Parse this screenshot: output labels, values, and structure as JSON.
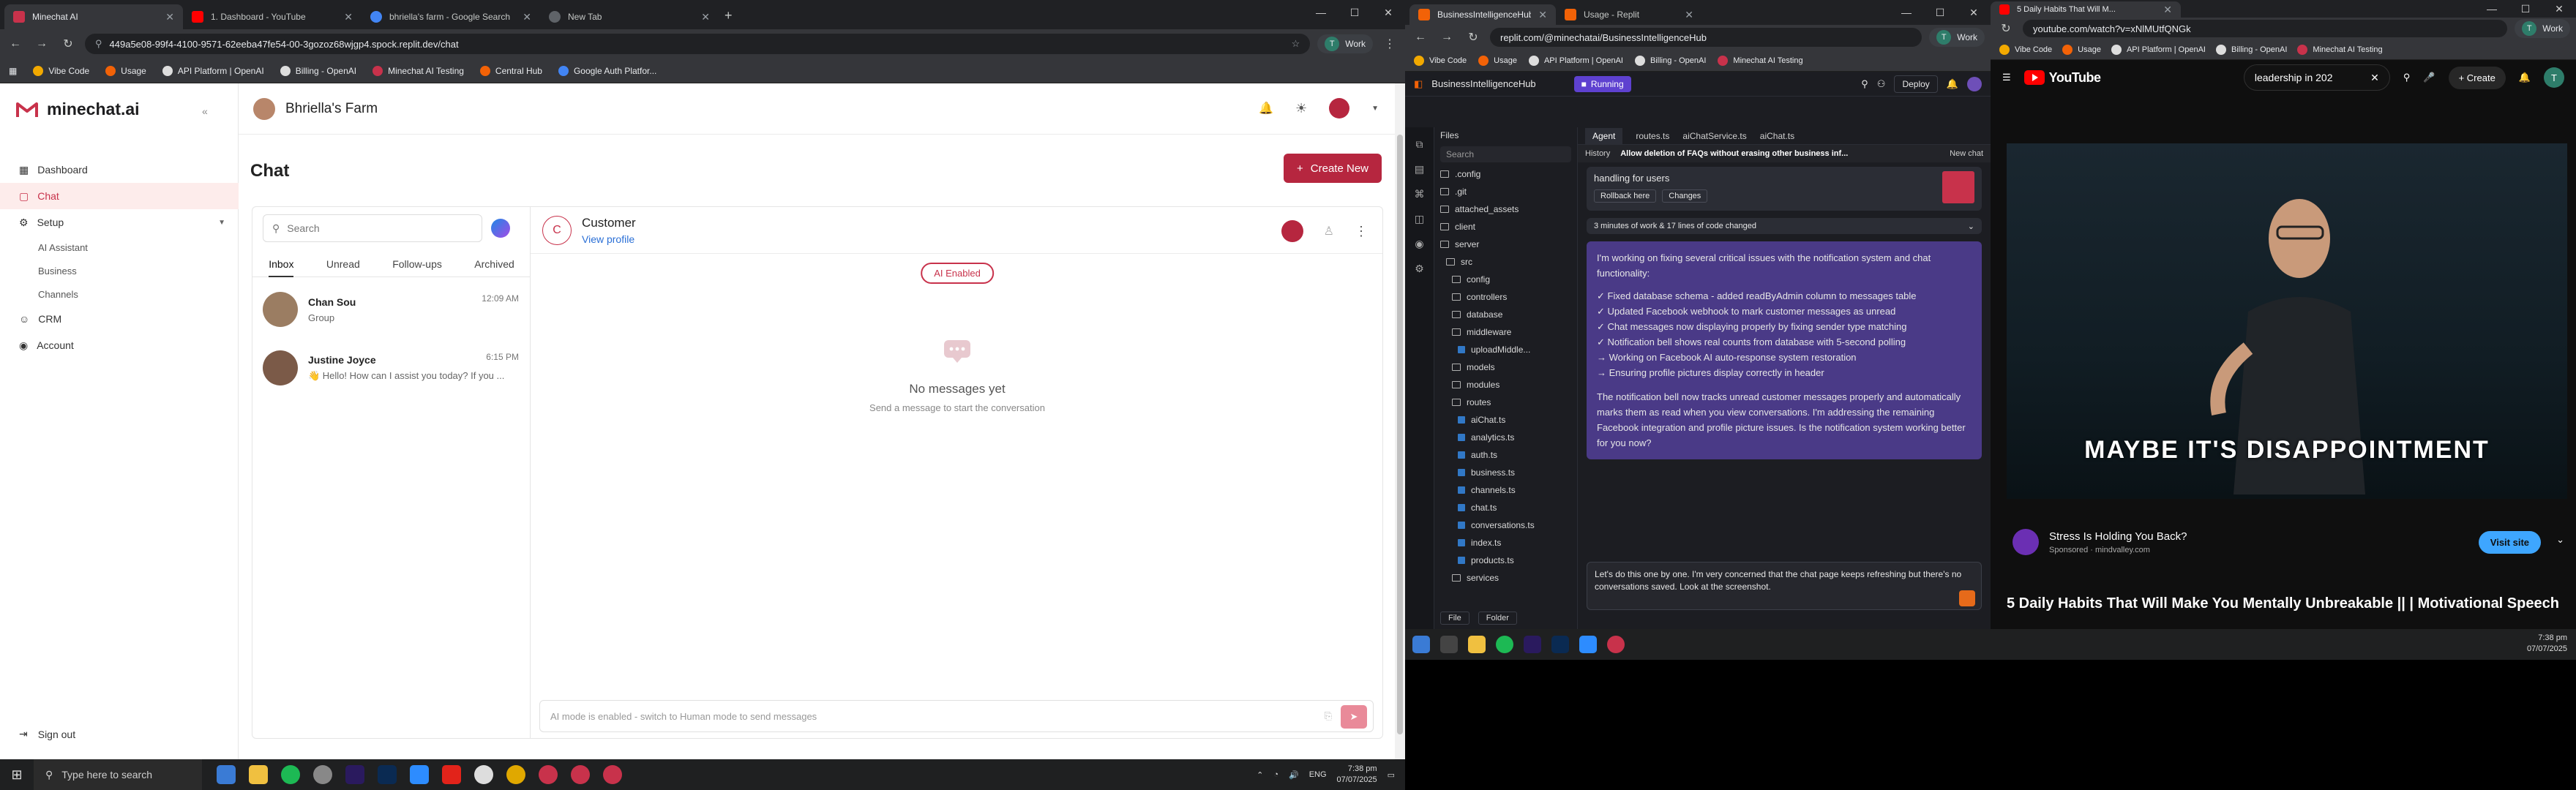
{
  "w1": {
    "tabs": [
      {
        "title": "Minechat AI",
        "color": "#c8324b"
      },
      {
        "title": "1. Dashboard - YouTube",
        "color": "#ff0000"
      },
      {
        "title": "bhriella's farm - Google Search",
        "color": "#4285f4"
      },
      {
        "title": "New Tab",
        "color": "#9aa0a6"
      }
    ],
    "url": "449a5e08-99f4-4100-9571-62eeba47fe54-00-3gozoz68wjgp4.spock.replit.dev/chat",
    "profile": "Work",
    "bookmarks": [
      "Vibe Code",
      "Usage",
      "API Platform | OpenAI",
      "Billing - OpenAI",
      "Minechat AI Testing",
      "Central Hub",
      "Google Auth Platfor..."
    ],
    "sidebar": {
      "brand": "minechat.ai",
      "items": [
        "Dashboard",
        "Chat",
        "Setup",
        "AI Assistant",
        "Business",
        "Channels",
        "CRM",
        "Account"
      ],
      "signout": "Sign out"
    },
    "topbar": {
      "farm": "Bhriella's Farm"
    },
    "page": {
      "title": "Chat",
      "create": "Create New"
    },
    "convlist": {
      "search_placeholder": "Search",
      "tabs": [
        "Inbox",
        "Unread",
        "Follow-ups",
        "Archived"
      ],
      "items": [
        {
          "name": "Chan Sou",
          "sub": "Group",
          "time": "12:09 AM"
        },
        {
          "name": "Justine Joyce",
          "sub": "👋 Hello! How can I assist you today? If you ...",
          "time": "6:15 PM"
        }
      ]
    },
    "chat": {
      "name": "Customer",
      "initial": "C",
      "view": "View profile",
      "badge": "AI Enabled",
      "empty_title": "No messages yet",
      "empty_sub": "Send a message to start the conversation",
      "composer": "AI mode is enabled - switch to Human mode to send messages"
    },
    "taskbar": {
      "search": "Type here to search",
      "lang": "ENG",
      "time": "7:38 pm",
      "date": "07/07/2025"
    }
  },
  "w2": {
    "tabs": [
      "BusinessIntelligenceHub - Repli",
      "Usage - Replit"
    ],
    "url": "replit.com/@minechatai/BusinessIntelligenceHub",
    "profile": "Work",
    "bookmarks": [
      "Vibe Code",
      "Usage",
      "API Platform | OpenAI",
      "Billing - OpenAI",
      "Minechat AI Testing"
    ],
    "project": "BusinessIntelligenceHub",
    "running": "Running",
    "deploy": "Deploy",
    "panels": {
      "files": "Files",
      "search": "Search",
      "file_btn": "File",
      "folder_btn": "Folder"
    },
    "tree": [
      ".config",
      ".git",
      "attached_assets",
      "client",
      "server",
      "src",
      "config",
      "controllers",
      "database",
      "middleware",
      "uploadMiddle...",
      "models",
      "modules",
      "routes",
      "aiChat.ts",
      "analytics.ts",
      "auth.ts",
      "business.ts",
      "channels.ts",
      "chat.ts",
      "conversations.ts",
      "index.ts",
      "products.ts",
      "services"
    ],
    "agent_tabs": [
      "Agent",
      "routes.ts",
      "aiChatService.ts",
      "aiChat.ts"
    ],
    "history": "History",
    "allow": "Allow deletion of FAQs without erasing other business inf...",
    "new_chat": "New chat",
    "top_card": "handling for users",
    "rollback": "Rollback here",
    "changes": "Changes",
    "summary": "3 minutes of work & 17 lines of code changed",
    "intro": "I'm working on fixing several critical issues with the notification system and chat functionality:",
    "checks": [
      "✓ Fixed database schema - added readByAdmin column to messages table",
      "✓ Updated Facebook webhook to mark customer messages as unread",
      "✓ Chat messages now displaying properly by fixing sender type matching",
      "✓ Notification bell shows real counts from database with 5-second polling",
      "→ Working on Facebook AI auto-response system restoration",
      "→ Ensuring profile pictures display correctly in header"
    ],
    "outro": "The notification bell now tracks unread customer messages properly and automatically marks them as read when you view conversations. I'm addressing the remaining Facebook integration and profile picture issues. Is the notification system working better for you now?",
    "input": "Let's do this one by one. I'm very concerned that the chat page keeps refreshing but there's no conversations saved. Look at the screenshot."
  },
  "w3": {
    "tab": "5 Daily Habits That Will M...",
    "url": "youtube.com/watch?v=xNlMUtfQNGk",
    "profile": "Work",
    "bookmarks": [
      "Vibe Code",
      "Usage",
      "API Platform | OpenAI",
      "Billing - OpenAI",
      "Minechat AI Testing"
    ],
    "brand": "YouTube",
    "search": "leadership in 202",
    "create": "Create",
    "caption": "MAYBE IT'S DISAPPOINTMENT",
    "ad_title": "Stress Is Holding You Back?",
    "ad_sponsor": "Sponsored · mindvalley.com",
    "ad_btn": "Visit site",
    "video_title": "5 Daily Habits That Will Make You Mentally Unbreakable || | Motivational Speech",
    "time": "7:38 pm",
    "date": "07/07/2025"
  }
}
